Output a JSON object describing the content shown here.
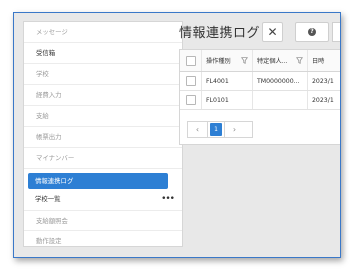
{
  "sidebar": {
    "items": [
      {
        "label": "メッセージ"
      },
      {
        "label": "受信箱"
      },
      {
        "label": "学校"
      },
      {
        "label": "経費入力"
      },
      {
        "label": "支給"
      },
      {
        "label": "帳票出力"
      },
      {
        "label": "マイナンバー"
      },
      {
        "label": "情報連携ログ"
      },
      {
        "label": "学校一覧"
      },
      {
        "label": "支給額照会"
      },
      {
        "label": "動作設定"
      }
    ],
    "more_label": "•••"
  },
  "main": {
    "title": "情報連携ログ",
    "close_label": "✕",
    "help_label": "?"
  },
  "grid": {
    "columns": [
      "操作種別",
      "特定個人...",
      "日時"
    ],
    "rows": [
      [
        "FL4001",
        "TM0000000...",
        "2023/1"
      ],
      [
        "FL0101",
        "",
        "2023/1"
      ]
    ]
  },
  "pagination": {
    "prev": "‹",
    "current": "1",
    "next": "›"
  },
  "colors": {
    "accent": "#2d7fd4",
    "frame_border": "#3a78c8"
  }
}
